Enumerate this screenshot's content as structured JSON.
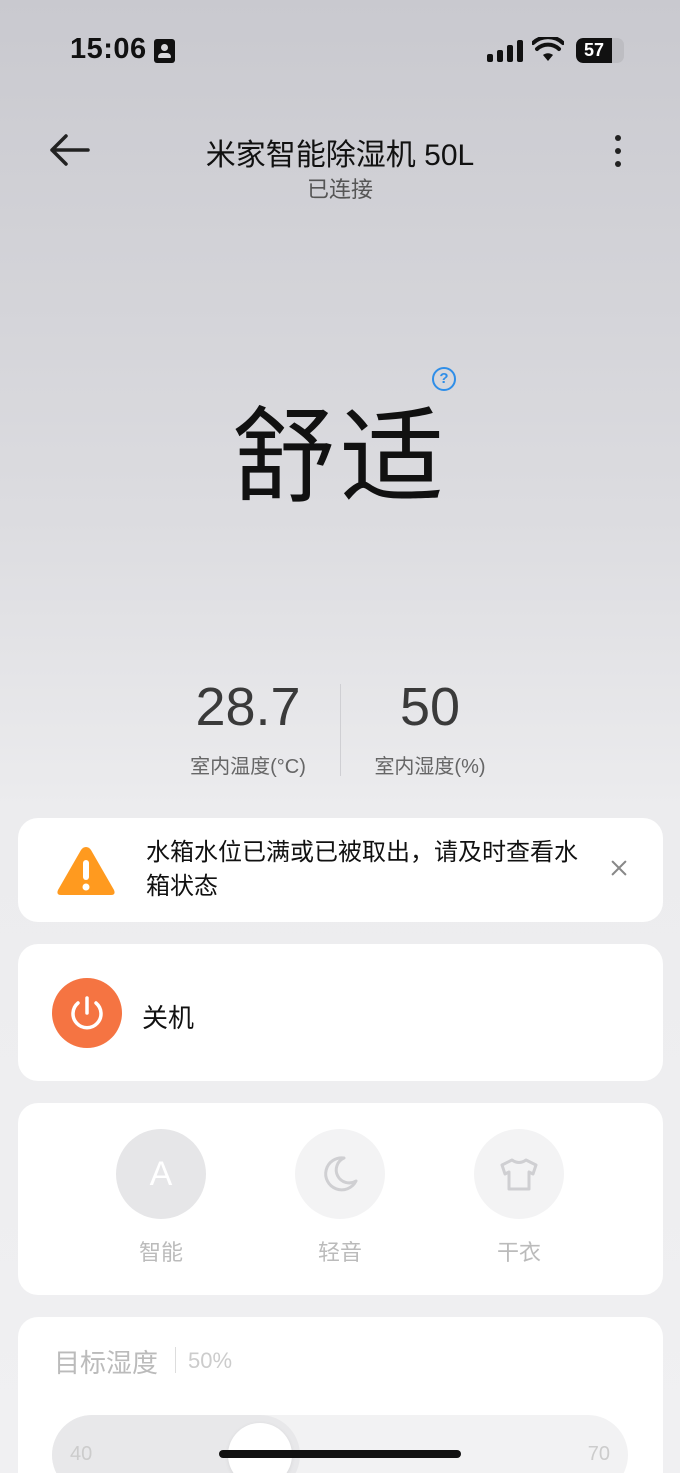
{
  "status_bar": {
    "time": "15:06",
    "battery": "57"
  },
  "header": {
    "title": "米家智能除湿机 50L",
    "subtitle": "已连接"
  },
  "mode_status": {
    "label": "舒适",
    "help": "?"
  },
  "readings": [
    {
      "value": "28.7",
      "label": "室内温度(°C)"
    },
    {
      "value": "50",
      "label": "室内湿度(%)"
    }
  ],
  "alert": {
    "text": "水箱水位已满或已被取出，请及时查看水箱状态"
  },
  "power": {
    "label": "关机",
    "color": "#f57442"
  },
  "modes": [
    {
      "label": "智能",
      "glyph": "A",
      "icon": "auto-icon",
      "active": true
    },
    {
      "label": "轻音",
      "icon": "moon-icon",
      "active": false
    },
    {
      "label": "干衣",
      "icon": "shirt-icon",
      "active": false
    }
  ],
  "target_humidity": {
    "title": "目标湿度",
    "value": "50%",
    "min": "40",
    "max": "70",
    "level_fraction": 0.33
  },
  "colors": {
    "accent": "#f57442",
    "warning": "#ff9a1f",
    "help": "#2f8ee8"
  }
}
